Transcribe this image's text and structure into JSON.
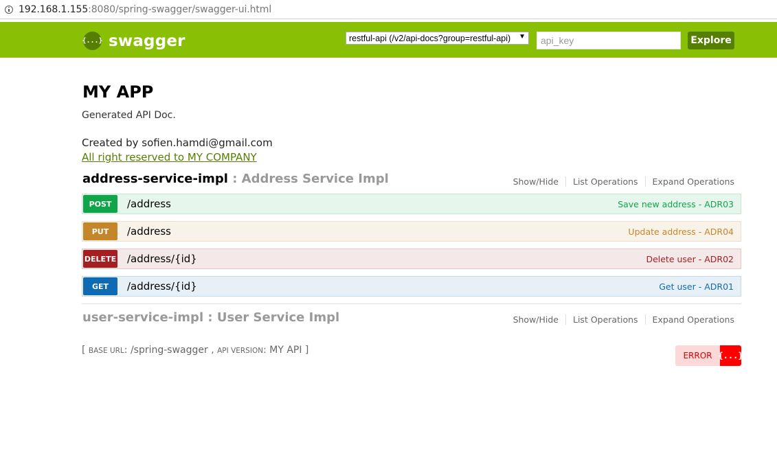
{
  "browser": {
    "url_host": "192.168.1.155",
    "url_path": ":8080/spring-swagger/swagger-ui.html"
  },
  "header": {
    "logo_glyph": "{...}",
    "logo_text": "swagger",
    "api_selector": "restful-api (/v2/api-docs?group=restful-api)",
    "api_key_placeholder": "api_key",
    "explore_label": "Explore",
    "bg_color": "#89bf04"
  },
  "info": {
    "title": "MY APP",
    "description": "Generated API Doc.",
    "contact": "Created by sofien.hamdi@gmail.com",
    "license": "All right reserved to MY COMPANY"
  },
  "resources": [
    {
      "name": "address-service-impl",
      "sep": " : ",
      "description": "Address Service Impl",
      "links": [
        "Show/Hide",
        "List Operations",
        "Expand Operations"
      ]
    },
    {
      "name": "user-service-impl",
      "sep": " : ",
      "description": "User Service Impl",
      "links": [
        "Show/Hide",
        "List Operations",
        "Expand Operations"
      ]
    }
  ],
  "operations": [
    {
      "method": "POST",
      "path": "/address",
      "summary": "Save new address - ADR03",
      "color": "#10a54a"
    },
    {
      "method": "PUT",
      "path": "/address",
      "summary": "Update address - ADR04",
      "color": "#c5862b"
    },
    {
      "method": "DELETE",
      "path": "/address/{id}",
      "summary": "Delete user - ADR02",
      "color": "#a41e22"
    },
    {
      "method": "GET",
      "path": "/address/{id}",
      "summary": "Get user - ADR01",
      "color": "#0f6ab4"
    }
  ],
  "footer": {
    "open": "[ ",
    "base_url_label": "Base URL",
    "base_url_value": ": /spring-swagger , ",
    "api_version_label": "API Version",
    "api_version_value": ": MY API ]"
  },
  "validator": {
    "label": "ERROR",
    "icon_glyph": "{...}"
  }
}
